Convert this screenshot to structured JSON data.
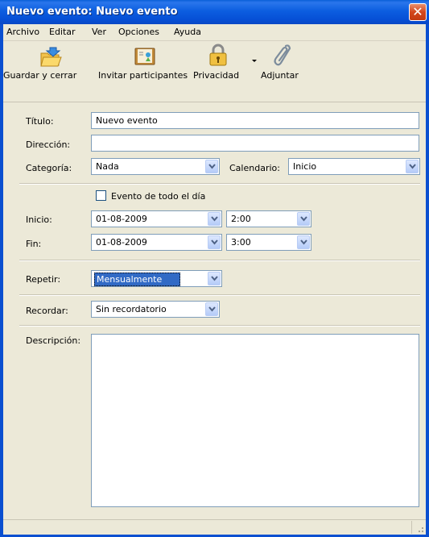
{
  "window": {
    "title": "Nuevo evento: Nuevo evento",
    "close_glyph": "✕",
    "title_color": "#0a5fd8"
  },
  "menubar": {
    "items": [
      "Archivo",
      "Editar",
      "Ver",
      "Opciones",
      "Ayuda"
    ]
  },
  "toolbar": {
    "buttons": [
      {
        "label": "Guardar y cerrar",
        "icon": "save-close-folder-icon"
      },
      {
        "label": "Invitar participantes",
        "icon": "invite-book-icon"
      },
      {
        "label": "Privacidad",
        "icon": "lock-icon"
      },
      {
        "label": "Adjuntar",
        "icon": "paperclip-icon"
      }
    ]
  },
  "form": {
    "title_label": "Título:",
    "title_value": "Nuevo evento",
    "address_label": "Dirección:",
    "address_value": "",
    "category_label": "Categoría:",
    "category_value": "Nada",
    "calendar_label": "Calendario:",
    "calendar_value": "Inicio",
    "allday_label": "Evento de todo el día",
    "allday_checked": false,
    "start_label": "Inicio:",
    "start_date": "01-08-2009",
    "start_time": "2:00",
    "end_label": "Fin:",
    "end_date": "01-08-2009",
    "end_time": "3:00",
    "repeat_label": "Repetir:",
    "repeat_value": "Mensualmente",
    "remind_label": "Recordar:",
    "remind_value": "Sin recordatorio",
    "description_label": "Descripción:",
    "description_value": ""
  }
}
